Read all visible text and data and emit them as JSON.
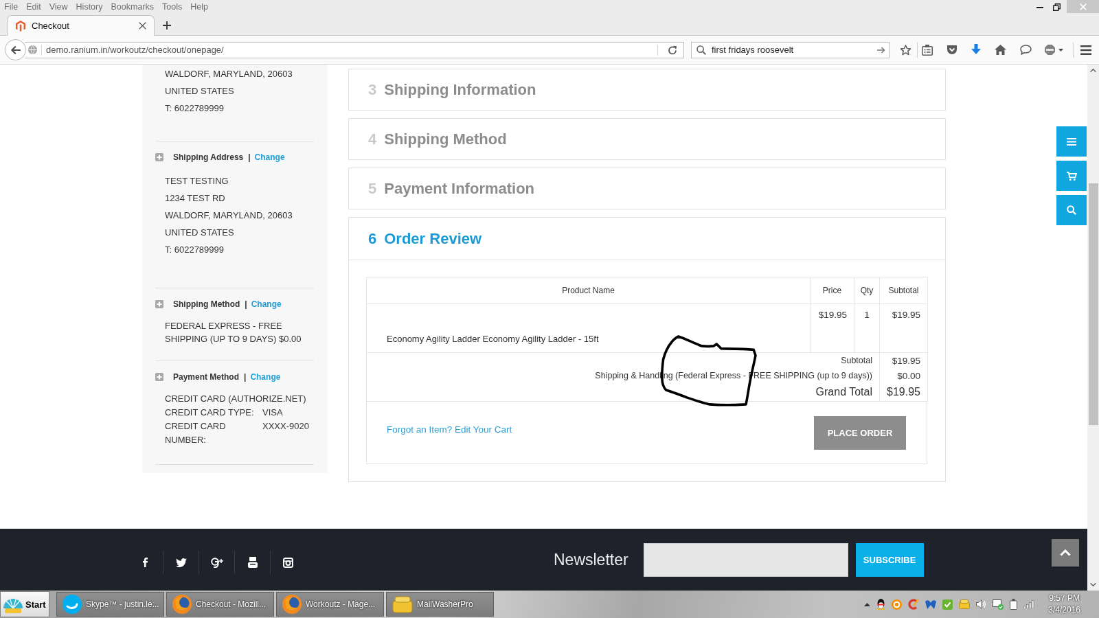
{
  "browser": {
    "menu": [
      "File",
      "Edit",
      "View",
      "History",
      "Bookmarks",
      "Tools",
      "Help"
    ],
    "tabs": [
      {
        "title": "Checkout",
        "selected": true
      }
    ],
    "address": "demo.ranium.in/workoutz/checkout/onepage/",
    "search": "first fridays roosevelt"
  },
  "sidebar": [
    {
      "kind": "address",
      "lines": [
        "WALDORF, MARYLAND, 20603",
        "UNITED STATES",
        "T: 6022789999"
      ]
    },
    {
      "kind": "address",
      "title": "Shipping Address",
      "separator": "|",
      "action": "Change",
      "lines": [
        "TEST TESTING",
        "1234 TEST RD",
        "WALDORF, MARYLAND, 20603",
        "UNITED STATES",
        "T: 6022789999"
      ]
    },
    {
      "kind": "method",
      "title": "Shipping Method",
      "separator": "|",
      "action": "Change",
      "lines": [
        "FEDERAL EXPRESS - FREE SHIPPING (UP TO 9 DAYS) $0.00"
      ]
    },
    {
      "kind": "payment",
      "title": "Payment Method",
      "separator": "|",
      "action": "Change",
      "lines": [
        "CREDIT CARD (AUTHORIZE.NET)"
      ],
      "fields": [
        {
          "label": "CREDIT CARD TYPE:",
          "value": "VISA"
        },
        {
          "label": "CREDIT CARD NUMBER:",
          "value": "XXXX-9020"
        }
      ]
    }
  ],
  "steps": [
    {
      "number": "3",
      "title": "Shipping Information",
      "active": false
    },
    {
      "number": "4",
      "title": "Shipping Method",
      "active": false
    },
    {
      "number": "5",
      "title": "Payment Information",
      "active": false
    },
    {
      "number": "6",
      "title": "Order Review",
      "active": true
    }
  ],
  "order_review": {
    "columns": [
      "Product Name",
      "Price",
      "Qty",
      "Subtotal"
    ],
    "items": [
      {
        "name": "Economy Agility Ladder Economy Agility Ladder - 15ft",
        "price": "$19.95",
        "qty": "1",
        "subtotal": "$19.95"
      }
    ],
    "totals": [
      {
        "kind": "line",
        "label": "Subtotal",
        "value": "$19.95"
      },
      {
        "kind": "line",
        "label": "Shipping & Handling (Federal Express - FREE SHIPPING (up to 9 days))",
        "value": "$0.00"
      },
      {
        "kind": "grand",
        "label": "Grand Total",
        "value": "$19.95"
      }
    ],
    "edit_link": "Forgot an Item? Edit Your Cart",
    "place_order": "PLACE ORDER"
  },
  "footer": {
    "newsletter": "Newsletter",
    "subscribe": "SUBSCRIBE"
  },
  "taskbar": {
    "start": "Start",
    "tasks": [
      {
        "kind": "chat",
        "title": "Skype™ - justin.le..."
      },
      {
        "kind": "browser",
        "title": "Checkout - Mozill..."
      },
      {
        "kind": "browser",
        "title": "Workoutz - Mage..."
      },
      {
        "kind": "mail",
        "title": "MailWasherPro"
      }
    ],
    "clock": {
      "time": "9:57 PM",
      "date": "3/4/2016"
    }
  }
}
